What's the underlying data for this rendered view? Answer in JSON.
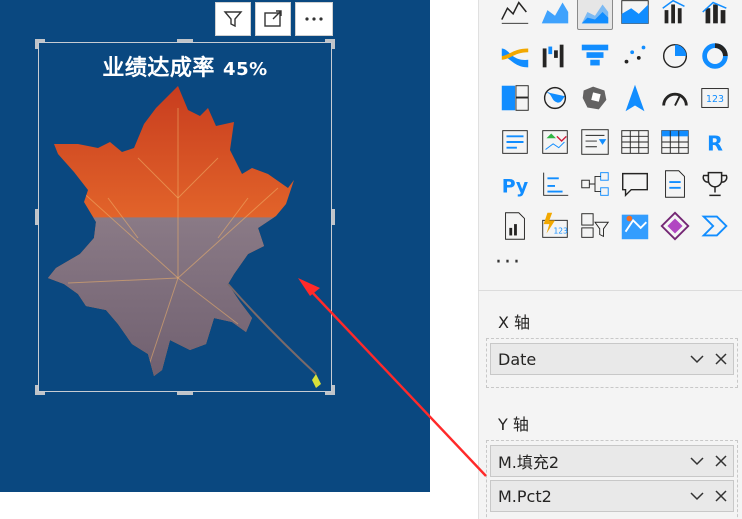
{
  "visual": {
    "title": "业绩达成率",
    "percent": "45%",
    "fill_fraction": 0.45
  },
  "header_icons": [
    "filter-icon",
    "focus-mode-icon",
    "more-options-icon"
  ],
  "pane": {
    "more": "···",
    "x_axis": {
      "label": "X 轴",
      "fields": [
        {
          "name": "Date"
        }
      ]
    },
    "y_axis": {
      "label": "Y 轴",
      "fields": [
        {
          "name": "M.填充2"
        },
        {
          "name": "M.Pct2"
        }
      ]
    }
  },
  "gallery": [
    "line-chart-icon",
    "area-chart-icon",
    "stacked-area-chart-icon",
    "ribbon-area-icon",
    "line-clustered-column-icon",
    "line-stacked-column-icon",
    "ribbon-chart-icon",
    "waterfall-chart-icon",
    "funnel-chart-icon",
    "scatter-chart-icon",
    "pie-chart-icon",
    "donut-chart-icon",
    "treemap-icon",
    "map-icon",
    "filled-map-icon",
    "azure-map-icon",
    "gauge-icon",
    "card-icon",
    "multi-row-card-icon",
    "kpi-icon",
    "slicer-icon",
    "table-icon",
    "matrix-icon",
    "r-visual-icon",
    "python-visual-icon",
    "key-influencers-icon",
    "decomposition-tree-icon",
    "qa-icon",
    "smart-narrative-icon",
    "trophy-icon",
    "paginated-report-icon",
    "power-apps-icon",
    "slicer-filter-icon",
    "arcgis-map-icon",
    "power-apps-diamond-icon",
    "power-automate-icon"
  ],
  "colors": {
    "canvas_bg": "#0a4880",
    "accent": "#118dff",
    "arrow": "#ff2a2a"
  }
}
